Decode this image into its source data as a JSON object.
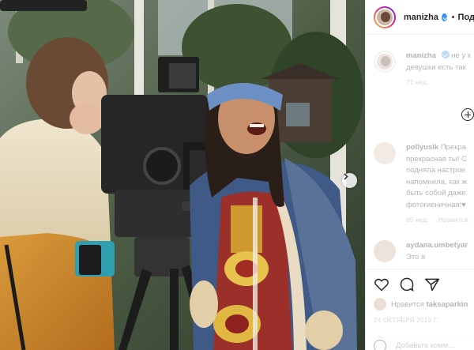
{
  "post": {
    "author": "manizha",
    "follow_separator": "•",
    "follow_label": "Под"
  },
  "caption": {
    "username": "manizha",
    "text_line1": "не у к",
    "text_line2": "девушки есть так",
    "time": "71 нед."
  },
  "comments": [
    {
      "username": "pollyusik",
      "lines": [
        "Прекра",
        "прекрасная ты! С",
        "подняла настрое",
        "напомнила, как ж",
        "быть собой даже",
        "фотогиеничная!♥"
      ],
      "time": "65 нед.",
      "reply": "Нравится: "
    },
    {
      "username": "aydana.umbetyar",
      "lines": [
        "Это я"
      ]
    }
  ],
  "likes": {
    "prefix": "Нравится",
    "user": "taksaparkin"
  },
  "date": "24 ОКТЯБРЯ 2019 Г.",
  "add_comment": {
    "placeholder": "Добавьте комм..."
  },
  "colors": {
    "verified": "#3897f0",
    "text": "#262626",
    "muted": "#8e8e8e"
  }
}
